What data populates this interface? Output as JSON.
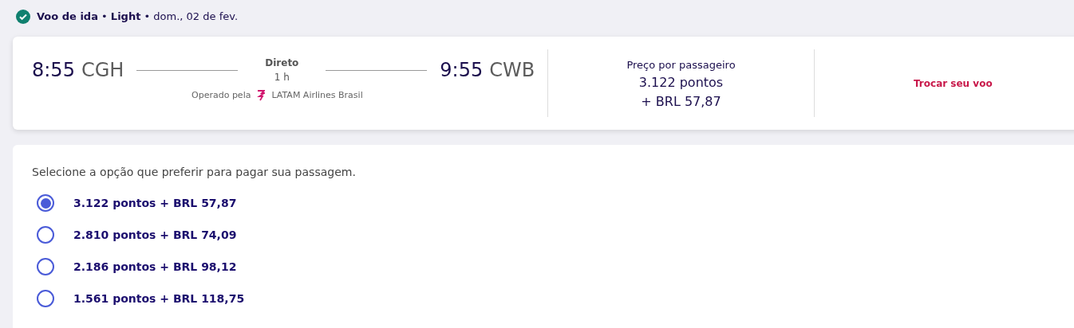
{
  "header": {
    "text": "**Voo de ida** • **Light** • dom., 02 de fev."
  },
  "flight": {
    "departure": {
      "time": "8:55",
      "airport": "CGH"
    },
    "stop": "Direto",
    "duration": "1 h",
    "arrival": {
      "time": "9:55",
      "airport": "CWB"
    },
    "operated_label": "Operado pela",
    "airline": "LATAM Airlines Brasil"
  },
  "price": {
    "label": "Preço por passageiro",
    "points": "3.122 pontos",
    "cash": "+ BRL 57,87"
  },
  "change_link": "Trocar seu voo",
  "payment": {
    "prompt": "Selecione a opção que preferir para pagar sua passagem.",
    "options": [
      {
        "label": "3.122 pontos + BRL 57,87",
        "selected": true
      },
      {
        "label": "2.810 pontos + BRL 74,09",
        "selected": false
      },
      {
        "label": "2.186 pontos + BRL 98,12",
        "selected": false
      },
      {
        "label": "1.561 pontos + BRL 118,75",
        "selected": false
      }
    ]
  }
}
